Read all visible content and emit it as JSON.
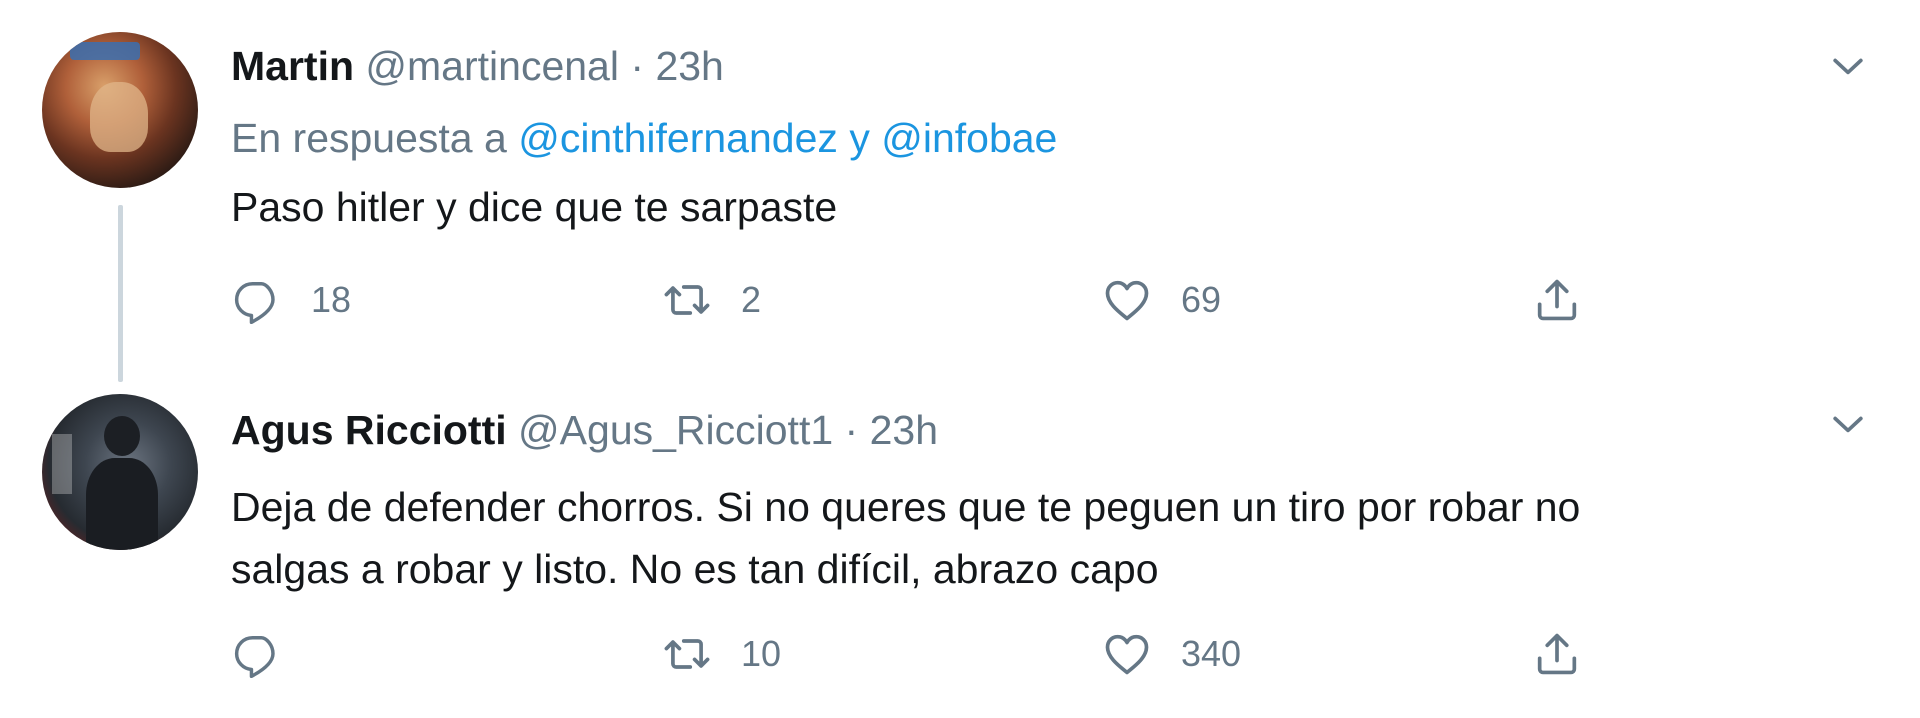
{
  "tweets": [
    {
      "name": "Martin",
      "handle": "@martincenal",
      "separator": "·",
      "time": "23h",
      "reply_prefix": "En respuesta a",
      "reply_mention_1": "@cinthifernandez",
      "reply_joiner": "y",
      "reply_mention_2": "@infobae",
      "text": "Paso hitler y dice que te sarpaste",
      "replies": "18",
      "retweets": "2",
      "likes": "69",
      "icons": [
        "reply-icon",
        "retweet-icon",
        "like-icon",
        "share-icon",
        "chevron-down-icon"
      ]
    },
    {
      "name": "Agus Ricciotti",
      "handle": "@Agus_Ricciott1",
      "separator": "·",
      "time": "23h",
      "text_line_1": "Deja de defender chorros. Si no queres que te peguen un tiro por robar no",
      "text_line_2": "salgas a robar y listo. No es tan difícil, abrazo capo",
      "replies": "",
      "retweets": "10",
      "likes": "340",
      "icons": [
        "reply-icon",
        "retweet-icon",
        "like-icon",
        "share-icon",
        "chevron-down-icon"
      ]
    }
  ],
  "colors": {
    "text": "#14171a",
    "secondary": "#657786",
    "link": "#1b95e0",
    "thread_line": "#ccd6dd"
  }
}
